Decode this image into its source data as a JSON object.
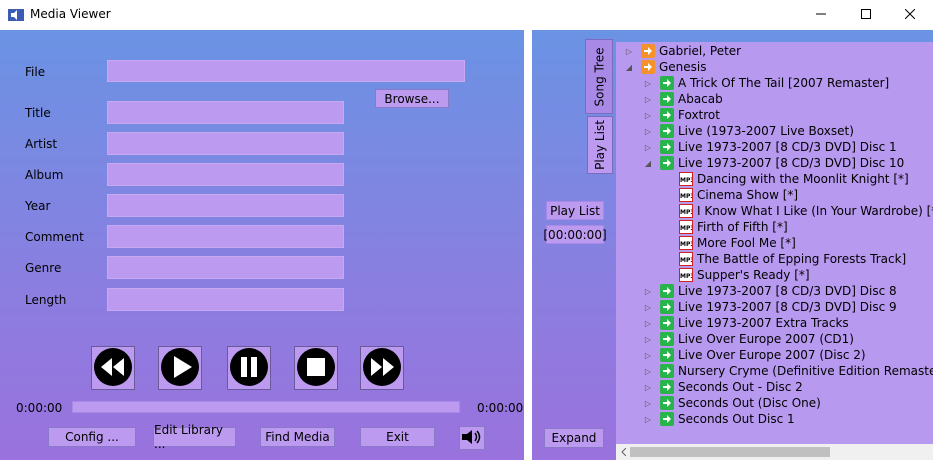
{
  "window": {
    "title": "Media Viewer",
    "controls": {
      "minimize": "minimize-icon",
      "maximize": "maximize-icon",
      "close": "close-icon"
    }
  },
  "form": {
    "file_label": "File",
    "browse_label": "Browse...",
    "title_label": "Title",
    "artist_label": "Artist",
    "album_label": "Album",
    "year_label": "Year",
    "comment_label": "Comment",
    "genre_label": "Genre",
    "length_label": "Length"
  },
  "player": {
    "controls": [
      "rewind-icon",
      "play-icon",
      "pause-icon",
      "stop-icon",
      "fast-forward-icon"
    ],
    "elapsed": "0:00:00",
    "total": "0:00:00",
    "progress": 0
  },
  "bottom_buttons": {
    "config": "Config ...",
    "edit_library": "Edit Library ...",
    "find_media": "Find Media",
    "exit": "Exit",
    "volume_icon": "speaker-icon"
  },
  "right_panel": {
    "tabs": [
      "Song Tree",
      "Play List"
    ],
    "playlist_label": "Play  List",
    "playlist_time": "[00:00:00]",
    "expand_label": "Expand"
  },
  "tree": {
    "rows": [
      {
        "level": 0,
        "expander": "▷",
        "icon": "orange",
        "label": "Gabriel, Peter"
      },
      {
        "level": 0,
        "expander": "◢",
        "icon": "orange",
        "label": "Genesis"
      },
      {
        "level": 1,
        "expander": "▷",
        "icon": "green",
        "label": "A Trick Of The Tail [2007 Remaster]"
      },
      {
        "level": 1,
        "expander": "▷",
        "icon": "green",
        "label": "Abacab"
      },
      {
        "level": 1,
        "expander": "▷",
        "icon": "green",
        "label": "Foxtrot"
      },
      {
        "level": 1,
        "expander": "▷",
        "icon": "green",
        "label": "Live (1973-2007 Live Boxset)"
      },
      {
        "level": 1,
        "expander": "▷",
        "icon": "green",
        "label": "Live 1973-2007 [8 CD/3 DVD] Disc 1"
      },
      {
        "level": 1,
        "expander": "◢",
        "icon": "green",
        "label": "Live 1973-2007 [8 CD/3 DVD] Disc 10"
      },
      {
        "level": 2,
        "expander": "",
        "icon": "mp3",
        "label": "Dancing with the Moonlit Knight [*]"
      },
      {
        "level": 2,
        "expander": "",
        "icon": "mp3",
        "label": "Cinema Show [*]"
      },
      {
        "level": 2,
        "expander": "",
        "icon": "mp3",
        "label": "I Know What I Like (In Your Wardrobe) [*"
      },
      {
        "level": 2,
        "expander": "",
        "icon": "mp3",
        "label": "Firth of Fifth [*]"
      },
      {
        "level": 2,
        "expander": "",
        "icon": "mp3",
        "label": "More Fool Me [*]"
      },
      {
        "level": 2,
        "expander": "",
        "icon": "mp3",
        "label": "The Battle of Epping Forests Track]"
      },
      {
        "level": 2,
        "expander": "",
        "icon": "mp3",
        "label": "Supper's Ready [*]"
      },
      {
        "level": 1,
        "expander": "▷",
        "icon": "green",
        "label": "Live 1973-2007 [8 CD/3 DVD] Disc 8"
      },
      {
        "level": 1,
        "expander": "▷",
        "icon": "green",
        "label": "Live 1973-2007 [8 CD/3 DVD] Disc 9"
      },
      {
        "level": 1,
        "expander": "▷",
        "icon": "green",
        "label": "Live 1973-2007 Extra Tracks"
      },
      {
        "level": 1,
        "expander": "▷",
        "icon": "green",
        "label": "Live Over Europe 2007 (CD1)"
      },
      {
        "level": 1,
        "expander": "▷",
        "icon": "green",
        "label": "Live Over Europe 2007 (Disc 2)"
      },
      {
        "level": 1,
        "expander": "▷",
        "icon": "green",
        "label": "Nursery Cryme (Definitive Edition Remaster)"
      },
      {
        "level": 1,
        "expander": "▷",
        "icon": "green",
        "label": "Seconds Out - Disc 2"
      },
      {
        "level": 1,
        "expander": "▷",
        "icon": "green",
        "label": "Seconds Out (Disc One)"
      },
      {
        "level": 1,
        "expander": "▷",
        "icon": "green",
        "label": "Seconds Out Disc 1"
      }
    ]
  },
  "colors": {
    "field": "#bb9af0",
    "gradient_top": "#6a93e4",
    "gradient_bottom": "#9a72dd",
    "folder_icon": "#f5922a",
    "album_icon": "#28b34b"
  }
}
